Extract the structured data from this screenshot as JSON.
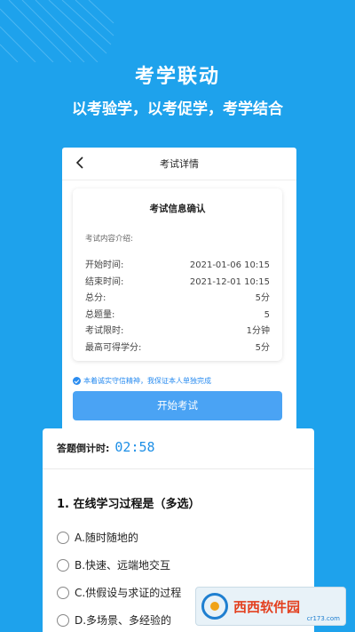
{
  "hero": {
    "title": "考学联动",
    "subtitle": "以考验学，以考促学，考学结合"
  },
  "phone": {
    "nav_title": "考试详情",
    "card_title": "考试信息确认",
    "intro_label": "考试内容介绍:",
    "rows": [
      {
        "label": "开始时间:",
        "value": "2021-01-06 10:15"
      },
      {
        "label": "结束时间:",
        "value": "2021-12-01 10:15"
      },
      {
        "label": "总分:",
        "value": "5分"
      },
      {
        "label": "总题量:",
        "value": "5"
      },
      {
        "label": "考试限时:",
        "value": "1分钟"
      },
      {
        "label": "最高可得学分:",
        "value": "5分"
      }
    ],
    "pledge": "本着诚实守信精神，我保证本人单独完成",
    "start_button": "开始考试"
  },
  "quiz": {
    "timer_label": "答题倒计时:",
    "timer_value": "02:58",
    "question": "1. 在线学习过程是（多选）",
    "options": [
      "A.随时随地的",
      "B.快速、远端地交互",
      "C.供假设与求证的过程",
      "D.多场景、多经验的"
    ]
  },
  "watermark": {
    "name": "西西软件园",
    "url": "cr173.com"
  },
  "colors": {
    "background": "#1ea2ec",
    "accent": "#4aa3f4",
    "timer": "#1e8fe6"
  }
}
